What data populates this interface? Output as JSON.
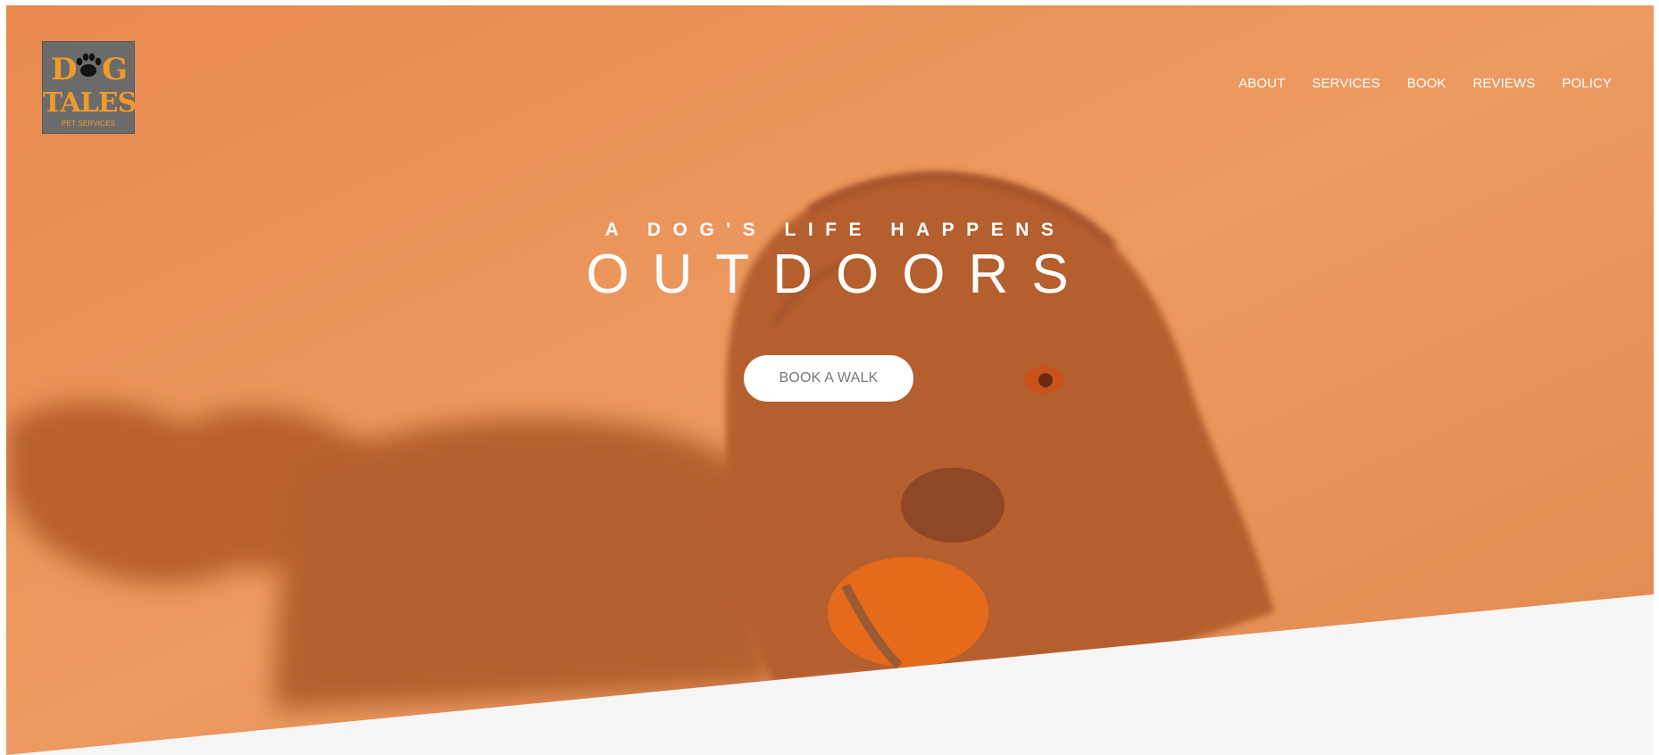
{
  "brand": {
    "logo_line1": "DOG",
    "logo_line2": "TALES",
    "logo_caption": "PET SERVICES"
  },
  "nav": {
    "items": [
      {
        "label": "ABOUT"
      },
      {
        "label": "SERVICES"
      },
      {
        "label": "BOOK"
      },
      {
        "label": "REVIEWS"
      },
      {
        "label": "POLICY"
      }
    ]
  },
  "hero": {
    "tagline": "A DOG'S LIFE HAPPENS",
    "headline": "OUTDOORS",
    "cta_label": "BOOK A WALK"
  },
  "colors": {
    "overlay": "#e8915a",
    "logo_orange": "#f09a2a",
    "logo_bg": "#6b6b6b",
    "section_below": "#f6f6f6",
    "cta_text": "#777777"
  },
  "icons": {
    "logo_emblem": "paw-print-icon"
  }
}
